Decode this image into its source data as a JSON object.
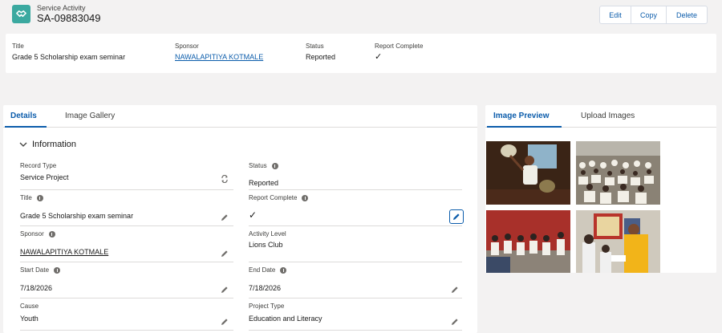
{
  "header": {
    "object_type": "Service Activity",
    "record_name": "SA-09883049",
    "icon": "handshake-icon",
    "buttons": {
      "edit": "Edit",
      "copy": "Copy",
      "delete": "Delete"
    },
    "fields": {
      "title_label": "Title",
      "title_value": "Grade 5 Scholarship exam seminar",
      "sponsor_label": "Sponsor",
      "sponsor_value": "NAWALAPITIYA KOTMALE",
      "status_label": "Status",
      "status_value": "Reported",
      "report_label": "Report Complete",
      "report_value": "✓"
    }
  },
  "left_tabs": {
    "details": "Details",
    "gallery": "Image Gallery"
  },
  "section": {
    "title": "Information"
  },
  "details": {
    "record_type_label": "Record Type",
    "record_type_value": "Service Project",
    "title_label": "Title",
    "title_value": "Grade 5 Scholarship exam seminar",
    "sponsor_label": "Sponsor",
    "sponsor_value": "NAWALAPITIYA KOTMALE",
    "start_label": "Start Date",
    "start_value": "7/18/2026",
    "cause_label": "Cause",
    "cause_value": "Youth",
    "status_label": "Status",
    "status_value": "Reported",
    "report_label": "Report Complete",
    "report_value": "✓",
    "activity_label": "Activity Level",
    "activity_value": "Lions Club",
    "end_label": "End Date",
    "end_value": "7/18/2026",
    "project_label": "Project Type",
    "project_value": "Education and Literacy"
  },
  "right_tabs": {
    "preview": "Image Preview",
    "upload": "Upload Images"
  },
  "colors": {
    "brand": "#0b5cab",
    "icon_bg": "#3ba9a0",
    "page_bg": "#f3f2f2"
  }
}
